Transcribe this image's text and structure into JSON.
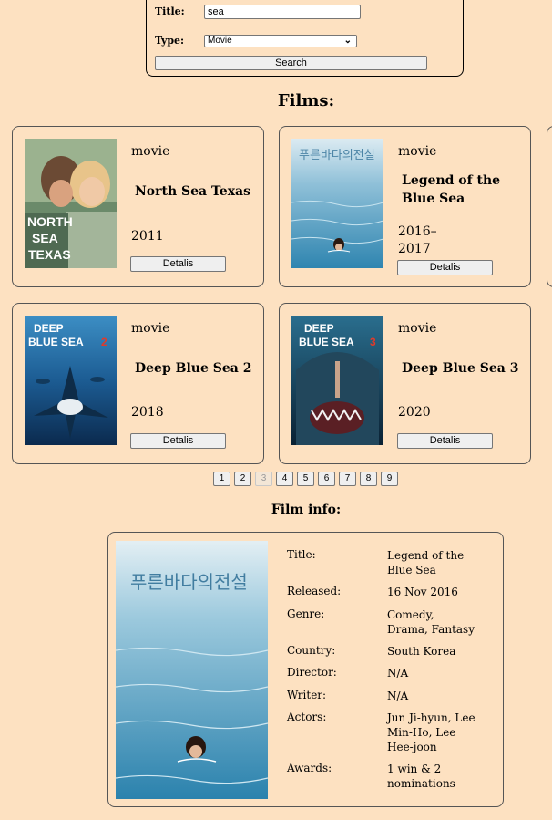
{
  "search": {
    "title_label": "Title:",
    "title_value": "sea",
    "type_label": "Type:",
    "type_value": "Movie",
    "button_label": "Search"
  },
  "films_heading": "Films:",
  "films": [
    {
      "type": "movie",
      "title": "North Sea Texas",
      "year": "2011",
      "details_label": "Detalis",
      "poster_text": "NORTH SEA TEXAS"
    },
    {
      "type": "movie",
      "title": "Legend of the Blue Sea",
      "year": "2016–2017",
      "details_label": "Detalis",
      "poster_text": "푸른바다의전설"
    },
    {
      "type": "movie",
      "title": "Deep Blue Sea 2",
      "year": "2018",
      "details_label": "Detalis",
      "poster_text": "DEEP BLUE SEA 2"
    },
    {
      "type": "movie",
      "title": "Deep Blue Sea 3",
      "year": "2020",
      "details_label": "Detalis",
      "poster_text": "DEEP BLUE SEA 3"
    }
  ],
  "pagination": {
    "pages": [
      "1",
      "2",
      "3",
      "4",
      "5",
      "6",
      "7",
      "8",
      "9"
    ],
    "current": "3"
  },
  "info": {
    "heading": "Film info:",
    "poster_text": "푸른바다의전설",
    "rows": [
      {
        "key": "Title:",
        "value": "Legend of the Blue Sea"
      },
      {
        "key": "Released:",
        "value": "16 Nov 2016"
      },
      {
        "key": "Genre:",
        "value": "Comedy, Drama, Fantasy"
      },
      {
        "key": "Country:",
        "value": "South Korea"
      },
      {
        "key": "Director:",
        "value": "N/A"
      },
      {
        "key": "Writer:",
        "value": "N/A"
      },
      {
        "key": "Actors:",
        "value": "Jun Ji-hyun, Lee Min-Ho, Lee Hee-joon"
      },
      {
        "key": "Awards:",
        "value": "1 win & 2 nominations"
      }
    ]
  },
  "colors": {
    "background": "#fde1c1",
    "border": "#555555",
    "button_bg": "#efefef"
  }
}
